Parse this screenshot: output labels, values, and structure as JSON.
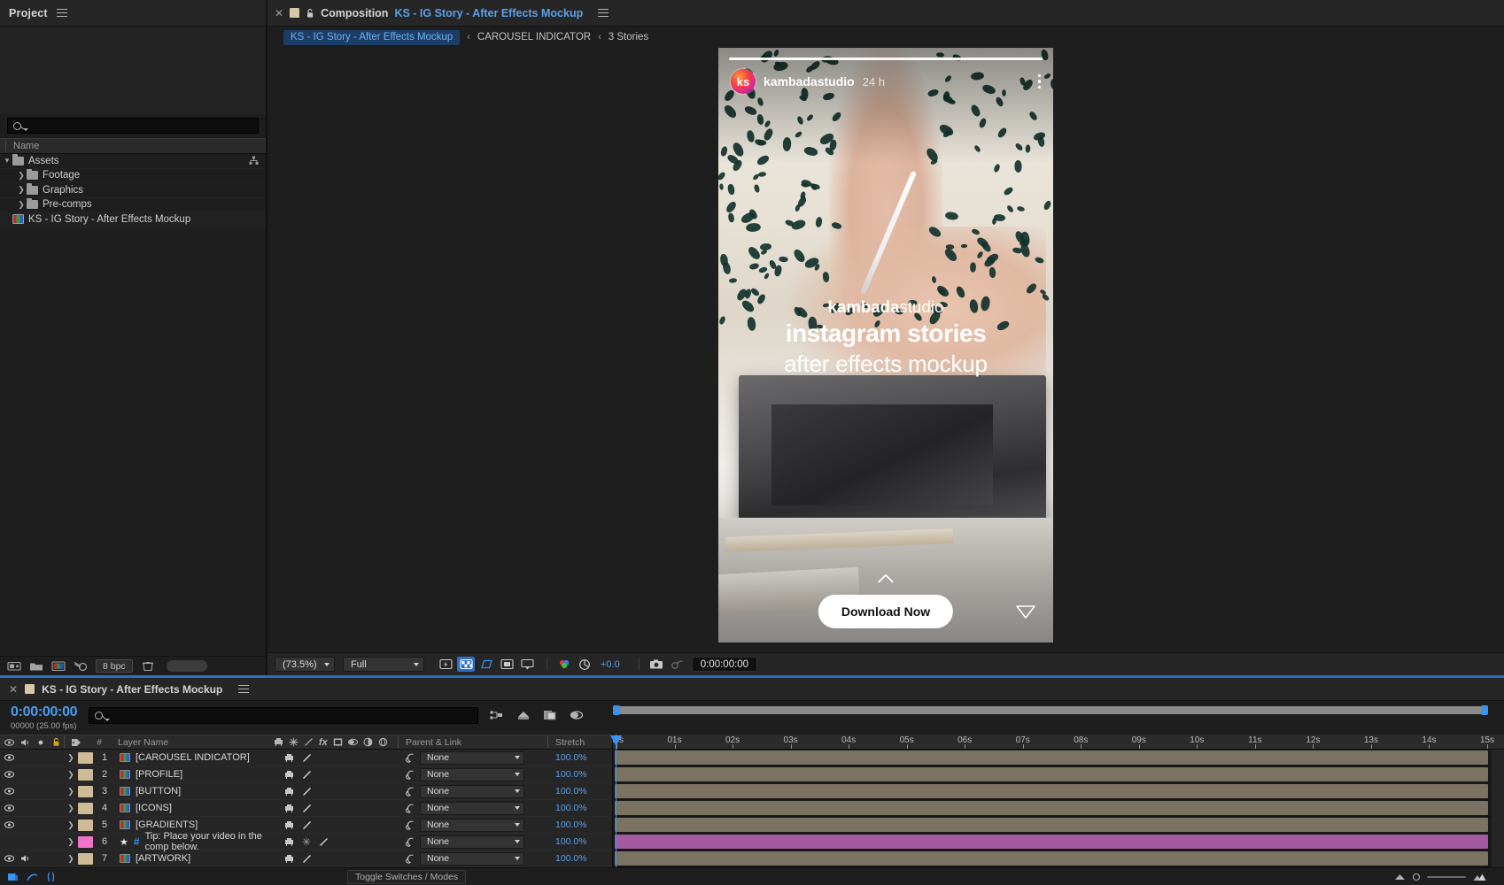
{
  "project_panel": {
    "tab_label": "Project",
    "search_placeholder": "",
    "column_header": "Name",
    "items": [
      {
        "label": "Assets",
        "type": "folder",
        "expanded": true,
        "indent": 0
      },
      {
        "label": "Footage",
        "type": "folder",
        "expanded": false,
        "indent": 1
      },
      {
        "label": "Graphics",
        "type": "folder",
        "expanded": false,
        "indent": 1
      },
      {
        "label": "Pre-comps",
        "type": "folder",
        "expanded": false,
        "indent": 1
      },
      {
        "label": "KS - IG Story - After Effects Mockup",
        "type": "composition",
        "expanded": false,
        "indent": 0
      }
    ],
    "bottom_bar": {
      "bit_depth": "8 bpc"
    }
  },
  "composition_panel": {
    "tab_prefix": "Composition",
    "tab_name": "KS - IG Story - After Effects Mockup",
    "breadcrumb": {
      "active": "KS - IG Story - After Effects Mockup",
      "sep": "‹",
      "crumb2": "CAROUSEL INDICATOR",
      "crumb3": "3 Stories"
    },
    "toolbar": {
      "zoom": "(73.5%)",
      "resolution": "Full",
      "exposure": "+0.0",
      "timecode": "0:00:00:00"
    },
    "story": {
      "username": "kambadastudio",
      "avatar_initials": "ks",
      "timestamp": "24 h",
      "brand_bold": "kambada",
      "brand_light": "studio",
      "headline": "instagram stories",
      "subhead": "after effects mockup",
      "cta_label": "Download Now"
    }
  },
  "timeline": {
    "tab_label": "KS - IG Story - After Effects Mockup",
    "current_time": "0:00:00:00",
    "frame_info": "00000 (25.00 fps)",
    "columns": {
      "num": "#",
      "layer_name": "Layer Name",
      "parent_link": "Parent & Link",
      "stretch": "Stretch"
    },
    "layers": [
      {
        "index": "1",
        "name": "[CAROUSEL INDICATOR]",
        "parent": "None",
        "stretch": "100.0%",
        "color": "#cdbc95",
        "bar_color": "#7c7261",
        "visible": true,
        "audio": false,
        "is_text_tip": false
      },
      {
        "index": "2",
        "name": "[PROFILE]",
        "parent": "None",
        "stretch": "100.0%",
        "color": "#cdbc95",
        "bar_color": "#7c7261",
        "visible": true,
        "audio": false,
        "is_text_tip": false
      },
      {
        "index": "3",
        "name": "[BUTTON]",
        "parent": "None",
        "stretch": "100.0%",
        "color": "#cdbc95",
        "bar_color": "#7c7261",
        "visible": true,
        "audio": false,
        "is_text_tip": false
      },
      {
        "index": "4",
        "name": "[ICONS]",
        "parent": "None",
        "stretch": "100.0%",
        "color": "#cdbc95",
        "bar_color": "#7c7261",
        "visible": true,
        "audio": false,
        "is_text_tip": false
      },
      {
        "index": "5",
        "name": "[GRADIENTS]",
        "parent": "None",
        "stretch": "100.0%",
        "color": "#cdbc95",
        "bar_color": "#7c7261",
        "visible": true,
        "audio": false,
        "is_text_tip": false
      },
      {
        "index": "6",
        "name": "Tip: Place your video in the comp below.",
        "parent": "None",
        "stretch": "100.0%",
        "color": "#f073c8",
        "bar_color": "#a35aa0",
        "visible": false,
        "audio": false,
        "is_text_tip": true
      },
      {
        "index": "7",
        "name": "[ARTWORK]",
        "parent": "None",
        "stretch": "100.0%",
        "color": "#cdbc95",
        "bar_color": "#7c7261",
        "visible": true,
        "audio": true,
        "is_text_tip": false
      }
    ],
    "ruler_ticks": [
      "00s",
      "01s",
      "02s",
      "03s",
      "04s",
      "05s",
      "06s",
      "07s",
      "08s",
      "09s",
      "10s",
      "11s",
      "12s",
      "13s",
      "14s",
      "15s"
    ],
    "status": {
      "toggle_switches_modes": "Toggle Switches / Modes"
    }
  },
  "colors": {
    "accent_blue": "#3a93f0",
    "link_blue": "#5aa0e8",
    "panel_bg": "#1e1e1e",
    "tab_bg": "#262626",
    "layer_tan": "#cdbc95",
    "layer_pink": "#f073c8"
  }
}
